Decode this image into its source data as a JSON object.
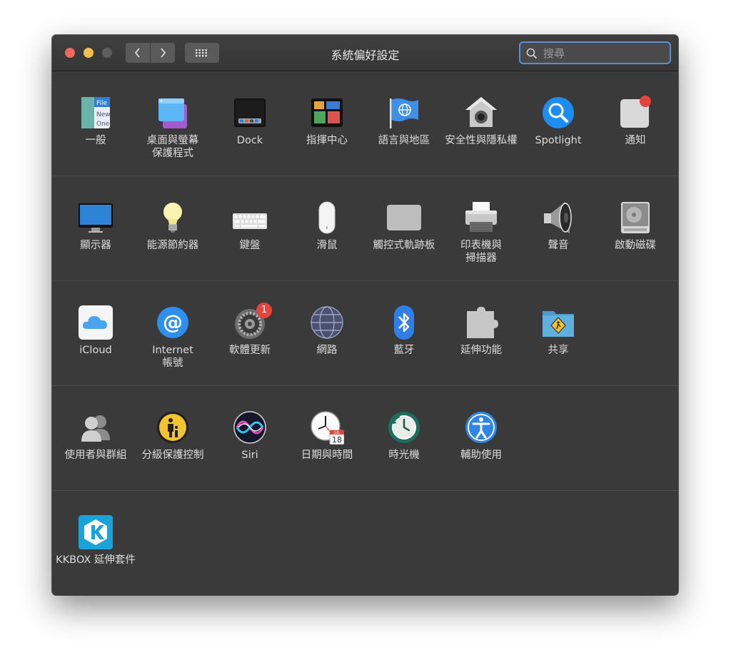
{
  "window": {
    "title": "系統偏好設定"
  },
  "search": {
    "placeholder": "搜尋"
  },
  "colors": {
    "accent": "#5b8ed6",
    "close": "#ed6a5e",
    "minimize": "#f5bf4f",
    "badge": "#e5443b"
  },
  "rows": [
    [
      {
        "label": "一般",
        "icon": "general-icon"
      },
      {
        "label": "桌面與螢幕\n保護程式",
        "icon": "desktop-screensaver-icon"
      },
      {
        "label": "Dock",
        "icon": "dock-icon"
      },
      {
        "label": "指揮中心",
        "icon": "mission-control-icon"
      },
      {
        "label": "語言與地區",
        "icon": "language-region-icon"
      },
      {
        "label": "安全性與隱私權",
        "icon": "security-privacy-icon"
      },
      {
        "label": "Spotlight",
        "icon": "spotlight-icon"
      },
      {
        "label": "通知",
        "icon": "notifications-icon"
      }
    ],
    [
      {
        "label": "顯示器",
        "icon": "displays-icon"
      },
      {
        "label": "能源節約器",
        "icon": "energy-saver-icon"
      },
      {
        "label": "鍵盤",
        "icon": "keyboard-icon"
      },
      {
        "label": "滑鼠",
        "icon": "mouse-icon"
      },
      {
        "label": "觸控式軌跡板",
        "icon": "trackpad-icon"
      },
      {
        "label": "印表機與\n掃描器",
        "icon": "printer-icon"
      },
      {
        "label": "聲音",
        "icon": "sound-icon"
      },
      {
        "label": "啟動磁碟",
        "icon": "startup-disk-icon"
      }
    ],
    [
      {
        "label": "iCloud",
        "icon": "icloud-icon"
      },
      {
        "label": "Internet\n帳號",
        "icon": "internet-accounts-icon"
      },
      {
        "label": "軟體更新",
        "icon": "software-update-icon",
        "badge": "1"
      },
      {
        "label": "網路",
        "icon": "network-icon"
      },
      {
        "label": "藍牙",
        "icon": "bluetooth-icon"
      },
      {
        "label": "延伸功能",
        "icon": "extensions-icon"
      },
      {
        "label": "共享",
        "icon": "sharing-icon"
      }
    ],
    [
      {
        "label": "使用者與群組",
        "icon": "users-groups-icon"
      },
      {
        "label": "分級保護控制",
        "icon": "parental-controls-icon"
      },
      {
        "label": "Siri",
        "icon": "siri-icon"
      },
      {
        "label": "日期與時間",
        "icon": "date-time-icon",
        "calendar_month": "JUL",
        "calendar_day": "18"
      },
      {
        "label": "時光機",
        "icon": "time-machine-icon"
      },
      {
        "label": "輔助使用",
        "icon": "accessibility-icon"
      }
    ],
    [
      {
        "label": "KKBOX 延伸套件",
        "icon": "kkbox-icon"
      }
    ]
  ]
}
